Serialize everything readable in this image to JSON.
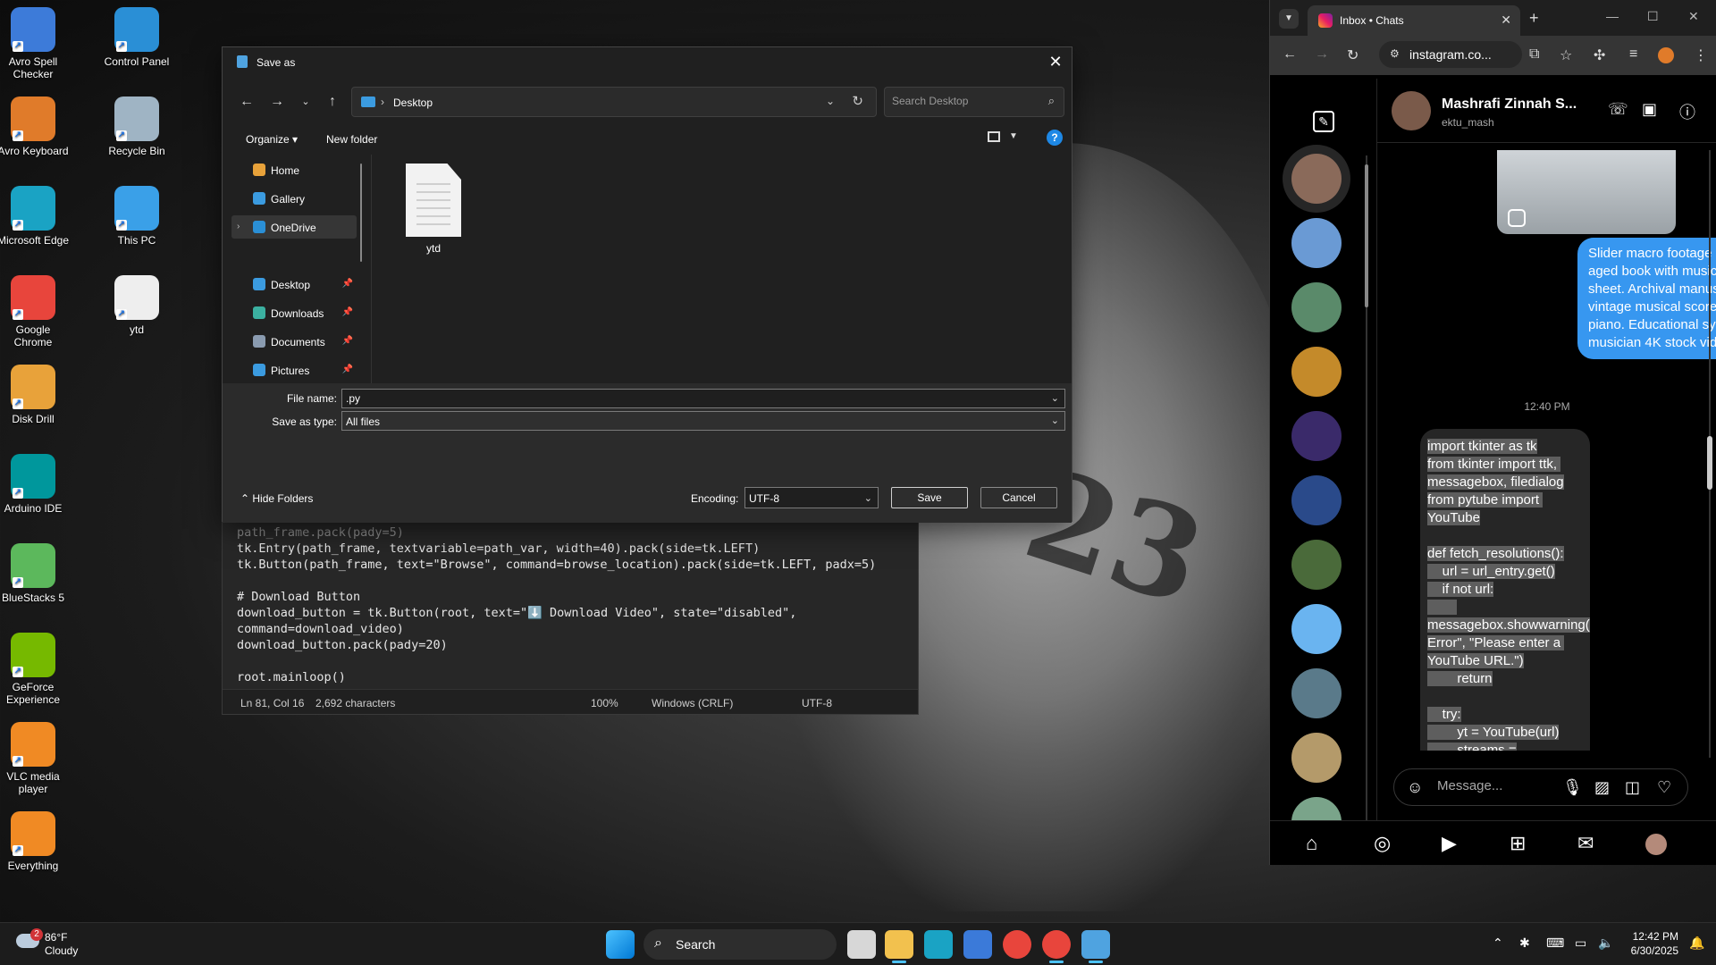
{
  "desktop": {
    "icons": [
      {
        "label": "Avro Spell Checker",
        "icon": "spell-checker-icon",
        "color": "#3d7bd9"
      },
      {
        "label": "Control Panel",
        "icon": "control-panel-icon",
        "color": "#2a8fd6"
      },
      {
        "label": "Avro Keyboard",
        "icon": "avro-keyboard-icon",
        "color": "#e07b2a"
      },
      {
        "label": "Recycle Bin",
        "icon": "recycle-bin-icon",
        "color": "#9fb4c4"
      },
      {
        "label": "Microsoft Edge",
        "icon": "edge-icon",
        "color": "#1aa3c4"
      },
      {
        "label": "This PC",
        "icon": "this-pc-icon",
        "color": "#3aa0e8"
      },
      {
        "label": "Google Chrome",
        "icon": "chrome-icon",
        "color": "#e8453c"
      },
      {
        "label": "ytd",
        "icon": "text-file-icon",
        "color": "#eeeeee"
      },
      {
        "label": "Disk Drill",
        "icon": "disk-drill-icon",
        "color": "#e8a23a"
      },
      {
        "label": "Arduino IDE",
        "icon": "arduino-icon",
        "color": "#00979c"
      },
      {
        "label": "BlueStacks 5",
        "icon": "bluestacks-icon",
        "color": "#5cb85c"
      },
      {
        "label": "GeForce Experience",
        "icon": "geforce-icon",
        "color": "#76b900"
      },
      {
        "label": "VLC media player",
        "icon": "vlc-icon",
        "color": "#f08a24"
      },
      {
        "label": "Everything",
        "icon": "everything-icon",
        "color": "#f08a24"
      }
    ]
  },
  "notepad": {
    "code_lines": [
      "path_frame.pack(pady=5)",
      "tk.Entry(path_frame, textvariable=path_var, width=40).pack(side=tk.LEFT)",
      "tk.Button(path_frame, text=\"Browse\", command=browse_location).pack(side=tk.LEFT, padx=5)",
      "",
      "# Download Button",
      "download_button = tk.Button(root, text=\"⬇️ Download Video\", state=\"disabled\",",
      "command=download_video)",
      "download_button.pack(pady=20)",
      "",
      "root.mainloop()"
    ],
    "status": {
      "position": "Ln 81, Col 16",
      "chars": "2,692 characters",
      "zoom": "100%",
      "line_ending": "Windows (CRLF)",
      "encoding": "UTF-8"
    }
  },
  "save_dialog": {
    "title": "Save as",
    "address": "Desktop",
    "search_placeholder": "Search Desktop",
    "organize_label": "Organize",
    "new_folder_label": "New folder",
    "nav_items": [
      {
        "label": "Home",
        "icon": "home-icon",
        "color": "#e8a23a"
      },
      {
        "label": "Gallery",
        "icon": "gallery-icon",
        "color": "#3b9be0"
      },
      {
        "label": "OneDrive",
        "icon": "onedrive-icon",
        "color": "#2a8fd6"
      },
      {
        "label": "Desktop",
        "icon": "desktop-folder-icon",
        "color": "#3b9be0"
      },
      {
        "label": "Downloads",
        "icon": "downloads-icon",
        "color": "#3bb0a0"
      },
      {
        "label": "Documents",
        "icon": "documents-icon",
        "color": "#8a9bb0"
      },
      {
        "label": "Pictures",
        "icon": "pictures-icon",
        "color": "#3b9be0"
      }
    ],
    "files": [
      {
        "name": "ytd"
      }
    ],
    "file_name_label": "File name:",
    "file_name_value": ".py",
    "save_type_label": "Save as type:",
    "save_type_value": "All files",
    "hide_folders_label": "Hide Folders",
    "encoding_label": "Encoding:",
    "encoding_value": "UTF-8",
    "save_label": "Save",
    "cancel_label": "Cancel"
  },
  "browser": {
    "tab_title": "Inbox • Chats",
    "url": "instagram.co...",
    "chat": {
      "name": "Mashrafi Zinnah S...",
      "username": "ektu_mash",
      "sent_message": "Slider macro footage of Mozart aged book with music notes sheet. Archival manuscripts, vintage musical score for piano. Educational symbols for musician 4K stock video",
      "time": "12:40 PM",
      "received_message": "import tkinter as tk\nfrom tkinter import ttk, messagebox, filedialog\nfrom pytube import YouTube\n\ndef fetch_resolutions():\n    url = url_entry.get()\n    if not url:\n        messagebox.showwarning(\"Input Error\", \"Please enter a YouTube URL.\")\n        return\n\n    try:\n        yt = YouTube(url)\n        streams =",
      "message_placeholder": "Message..."
    },
    "avatar_colors": [
      "#8a6a5a",
      "#6a9ad4",
      "#5a8a6a",
      "#c48a2a",
      "#3a2a6a",
      "#2a4a8a",
      "#4a6a3a",
      "#6ab4f0",
      "#5a7a8a",
      "#b49a6a",
      "#7aa48a"
    ]
  },
  "taskbar": {
    "weather_temp": "86°F",
    "weather_cond": "Cloudy",
    "weather_badge": "2",
    "search_label": "Search",
    "time": "12:42 PM",
    "date": "6/30/2025"
  }
}
